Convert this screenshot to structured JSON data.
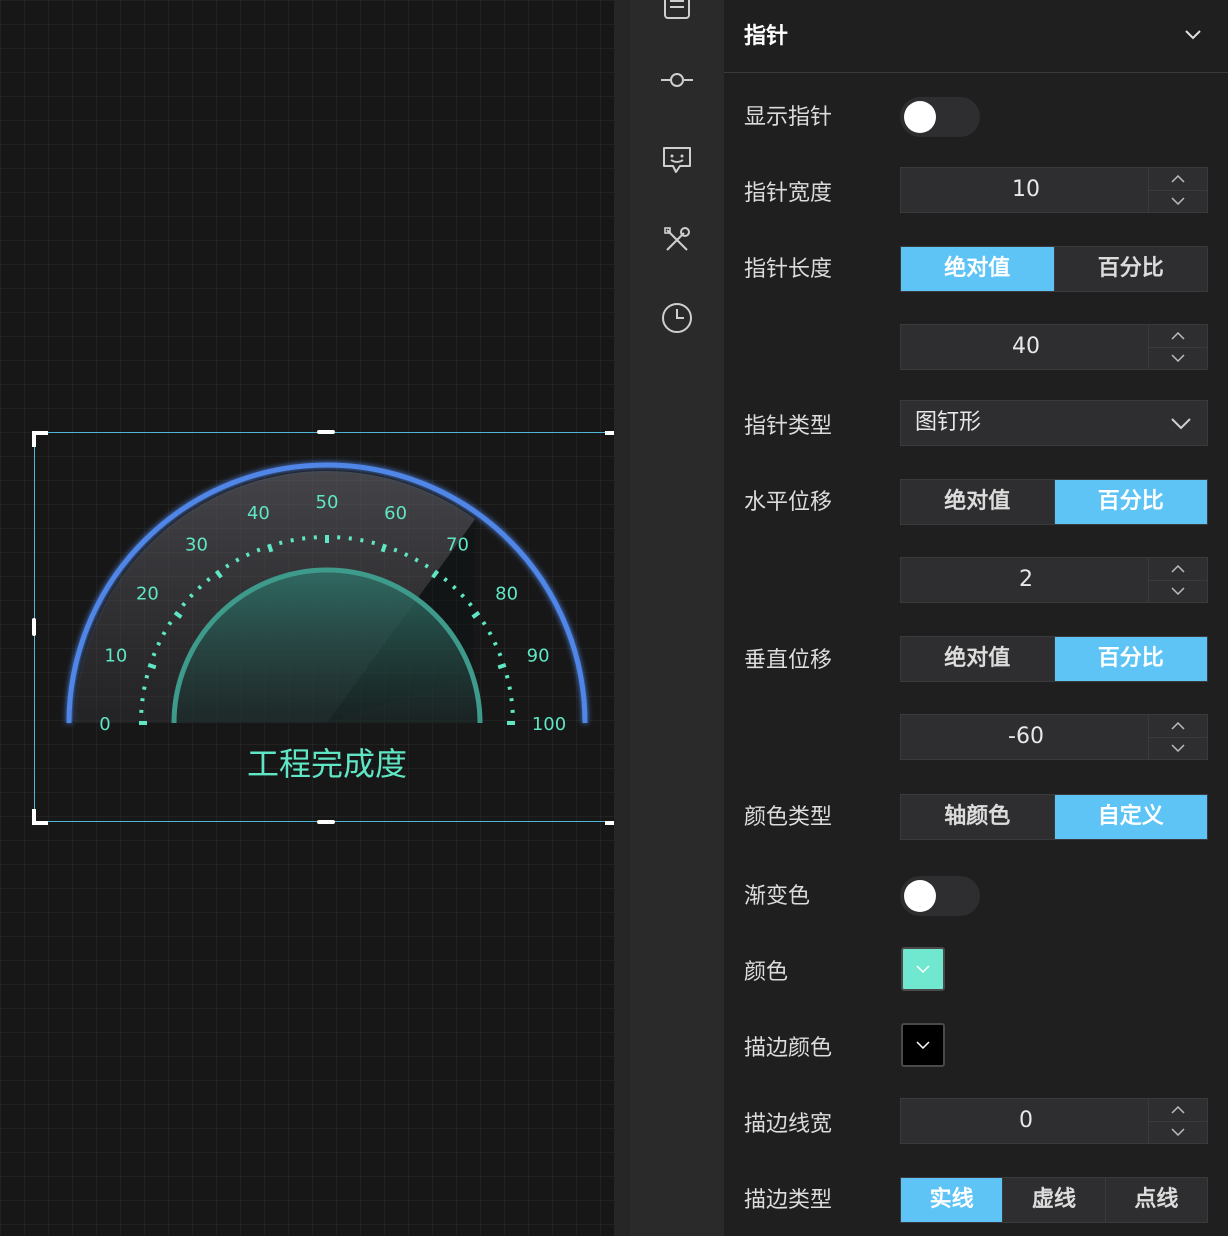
{
  "gauge": {
    "title": "工程完成度",
    "min": 0,
    "max": 100,
    "value": 70,
    "ticks": [
      "0",
      "10",
      "20",
      "30",
      "40",
      "50",
      "60",
      "70",
      "80",
      "90",
      "100"
    ],
    "colors": {
      "outer_ring": "#4f86e8",
      "tick": "#5fe6c4",
      "inner_ring": "#3e9a8a",
      "label": "#5fe6c4"
    }
  },
  "rail": {
    "icons": [
      "list-icon",
      "commit-icon",
      "chat-bubble-icon",
      "tools-icon",
      "clock-icon"
    ]
  },
  "panel": {
    "title": "指针",
    "show_pointer": {
      "label": "显示指针"
    },
    "pointer_width": {
      "label": "指针宽度",
      "value": "10"
    },
    "pointer_length": {
      "label": "指针长度",
      "options": [
        "绝对值",
        "百分比"
      ],
      "selected": "绝对值",
      "value": "40"
    },
    "pointer_type": {
      "label": "指针类型",
      "value": "图钉形"
    },
    "h_offset": {
      "label": "水平位移",
      "options": [
        "绝对值",
        "百分比"
      ],
      "selected": "百分比",
      "value": "2"
    },
    "v_offset": {
      "label": "垂直位移",
      "options": [
        "绝对值",
        "百分比"
      ],
      "selected": "百分比",
      "value": "-60"
    },
    "color_type": {
      "label": "颜色类型",
      "options": [
        "轴颜色",
        "自定义"
      ],
      "selected": "自定义"
    },
    "gradient": {
      "label": "渐变色"
    },
    "color": {
      "label": "颜色",
      "value": "#6fe8cf"
    },
    "stroke_color": {
      "label": "描边颜色",
      "value": "#000000"
    },
    "stroke_width": {
      "label": "描边线宽",
      "value": "0"
    },
    "stroke_type": {
      "label": "描边类型",
      "options": [
        "实线",
        "虚线",
        "点线"
      ],
      "selected": "实线"
    }
  },
  "accent": "#5dc4f5"
}
